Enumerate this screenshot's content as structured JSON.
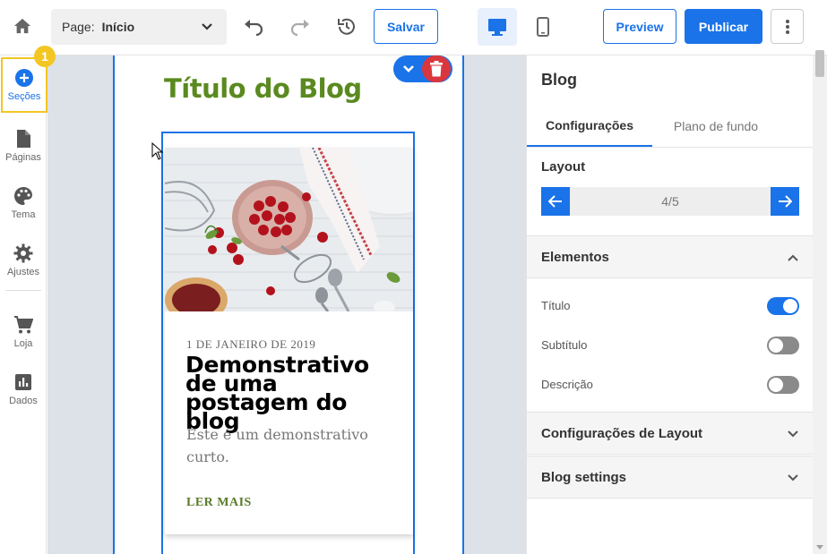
{
  "topbar": {
    "page_label": "Page:",
    "page_value": "Início",
    "save_label": "Salvar",
    "preview_label": "Preview",
    "publish_label": "Publicar"
  },
  "sidebar": {
    "badge": "1",
    "items": [
      {
        "label": "Seções",
        "icon": "plus-circle-icon"
      },
      {
        "label": "Páginas",
        "icon": "page-icon"
      },
      {
        "label": "Tema",
        "icon": "palette-icon"
      },
      {
        "label": "Ajustes",
        "icon": "gear-icon"
      },
      {
        "label": "Loja",
        "icon": "cart-icon"
      },
      {
        "label": "Dados",
        "icon": "chart-icon"
      }
    ]
  },
  "preview": {
    "blog_title": "Título do Blog",
    "post": {
      "date": "1 DE JANEIRO DE 2019",
      "title": "Demonstrativo de uma postagem do blog",
      "description": "Este é um demonstrativo curto.",
      "read_more": "LER MAIS"
    }
  },
  "panel": {
    "title": "Blog",
    "tabs": [
      "Configurações",
      "Plano de fundo"
    ],
    "layout_label": "Layout",
    "layout_value": "4/5",
    "elements_header": "Elementos",
    "toggles": [
      {
        "label": "Título",
        "on": true
      },
      {
        "label": "Subtítulo",
        "on": false
      },
      {
        "label": "Descrição",
        "on": false
      }
    ],
    "layout_settings_header": "Configurações de Layout",
    "blog_settings_header": "Blog settings"
  },
  "colors": {
    "accent": "#1a73e8",
    "title_green": "#5a8a1f",
    "delete_red": "#d9363e",
    "highlight_yellow": "#f3c623"
  }
}
